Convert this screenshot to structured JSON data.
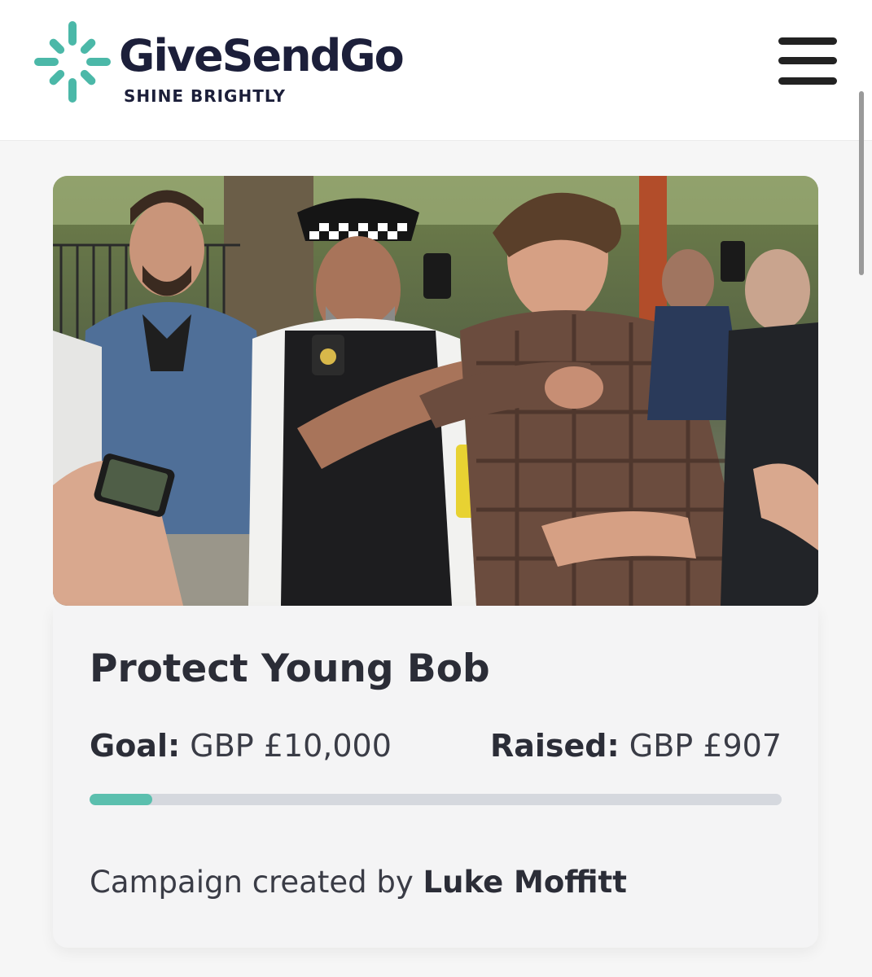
{
  "header": {
    "brand_name": "GiveSendGo",
    "tagline": "SHINE BRIGHTLY",
    "logo_icon": "sunburst-logo-icon",
    "menu_icon": "hamburger-menu-icon",
    "brand_color": "#4bb8a8",
    "text_color": "#1c1f3a"
  },
  "campaign": {
    "image_description_icon": "campaign-photo",
    "title": "Protect Young Bob",
    "goal_label": "Goal:",
    "goal_value": "GBP £10,000",
    "raised_label": "Raised:",
    "raised_value": "GBP £907",
    "progress_fraction": 0.0907,
    "progress_color": "#5bbfae",
    "creator_prefix": "Campaign created by",
    "creator_name": "Luke Moffitt"
  }
}
